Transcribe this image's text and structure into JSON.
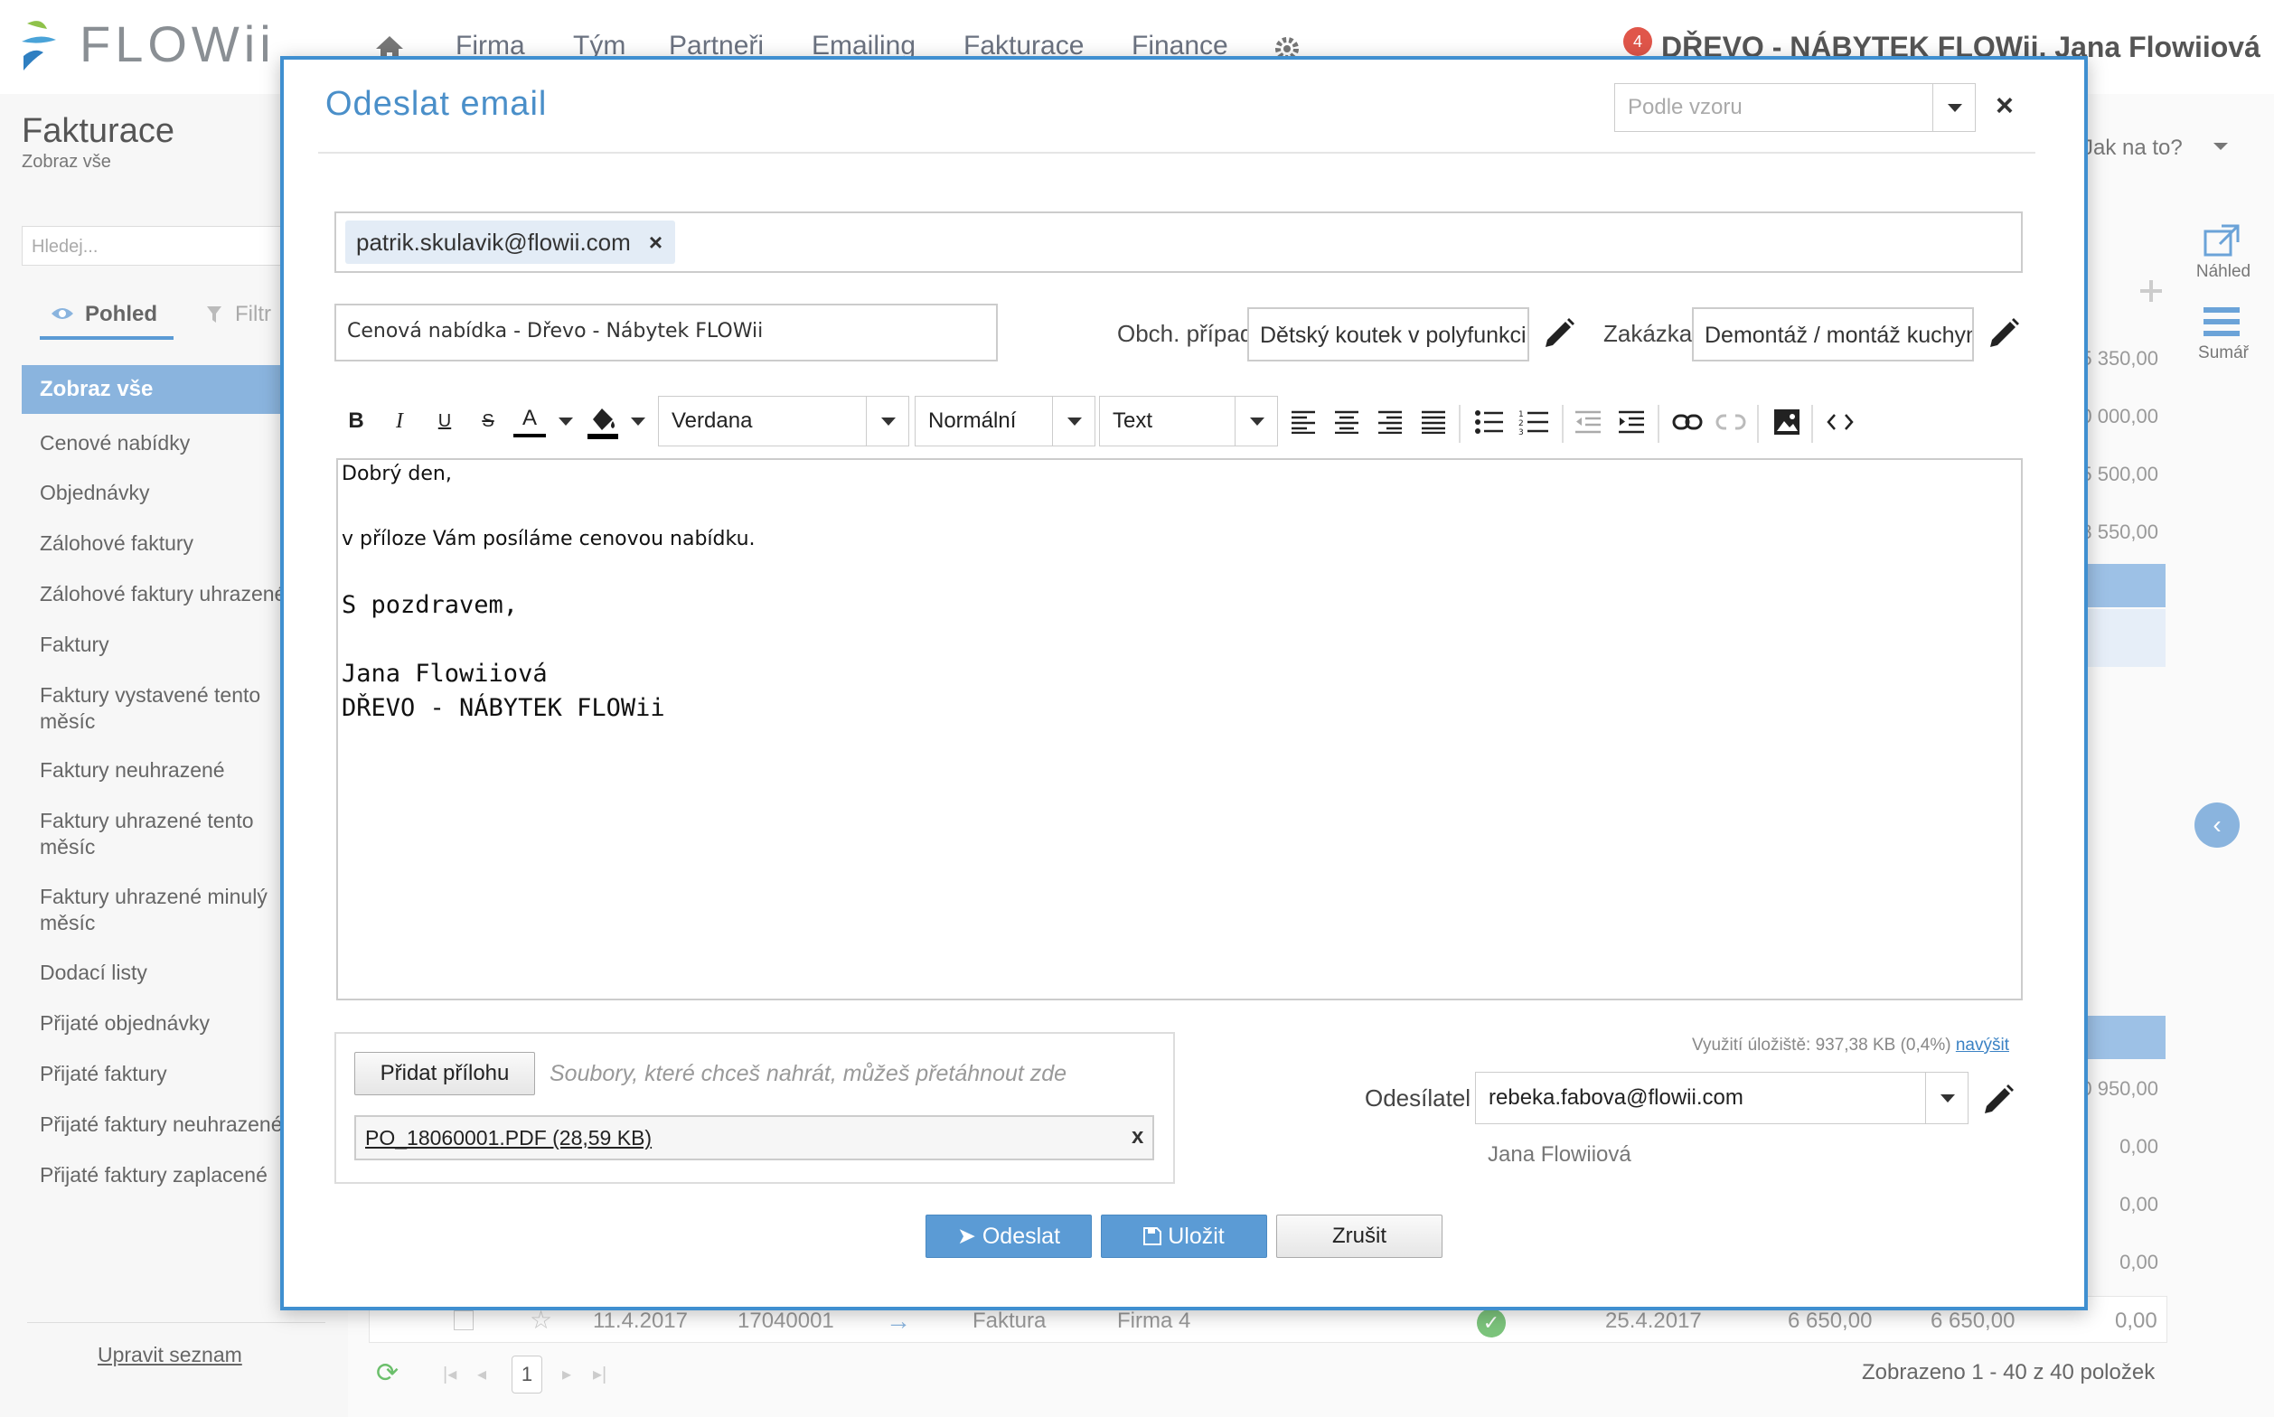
{
  "app": {
    "logo": "FLOWii",
    "nav": [
      "Firma",
      "Tým",
      "Partneři",
      "Emailing",
      "Fakturace",
      "Finance"
    ],
    "notification_count": "4",
    "company_user": "DŘEVO - NÁBYTEK FLOWii, Jana Flowiiová"
  },
  "sidebar": {
    "title": "Fakturace",
    "subtitle": "Zobraz vše",
    "search_placeholder": "Hledej...",
    "tab_view": "Pohled",
    "tab_filter": "Filtr",
    "active_item": "Zobraz vše",
    "items": [
      "Cenové nabídky",
      "Objednávky",
      "Zálohové faktury",
      "Zálohové faktury uhrazené",
      "Faktury",
      "Faktury vystavené tento měsíc",
      "Faktury neuhrazené",
      "Faktury uhrazené tento měsíc",
      "Faktury uhrazené minulý měsíc",
      "Dodací listy",
      "Přijaté objednávky",
      "Přijaté faktury",
      "Přijaté faktury neuhrazené",
      "Přijaté faktury zaplacené"
    ],
    "edit_list": "Upravit seznam"
  },
  "background": {
    "help": "Jak na to?",
    "preview": "Náhled",
    "summary": "Sumář",
    "amounts": [
      "5 350,00",
      "0 000,00",
      "5 500,00",
      "8 550,00",
      "0 950,00",
      "0,00",
      "0,00",
      "0,00",
      "0,00"
    ],
    "last_row": {
      "date": "11.4.2017",
      "number": "17040001",
      "type": "Faktura",
      "partner": "Firma 4",
      "due": "25.4.2017",
      "total": "6 650,00",
      "total2": "6 650,00",
      "remaining": "0,00"
    },
    "page": "1",
    "status": "Zobrazeno 1 - 40 z 40 položek"
  },
  "modal": {
    "title": "Odeslat email",
    "template_placeholder": "Podle vzoru",
    "recipient": "patrik.skulavik@flowii.com",
    "subject": "Cenová nabídka - Dřevo - Nábytek FLOWii",
    "case_label": "Obch. případ",
    "case_value": "Dětský koutek v polyfunkci",
    "order_label": "Zakázka",
    "order_value": "Demontáž / montáž kuchyně",
    "toolbar": {
      "font": "Verdana",
      "size": "Normální",
      "format": "Text"
    },
    "body": {
      "line1": "Dobrý den,",
      "line2": "v příloze Vám posíláme cenovou nabídku.",
      "line3": "S pozdravem,",
      "line4": "Jana Flowiiová",
      "line5": "DŘEVO - NÁBYTEK FLOWii"
    },
    "attach_button": "Přidat přílohu",
    "drop_hint": "Soubory, které chceš nahrát, můžeš přetáhnout zde",
    "attachment": "PO_18060001.PDF (28,59 KB)",
    "storage_text": "Využití úložiště: 937,38 KB (0,4%)",
    "storage_link": "navýšit",
    "sender_label": "Odesílatel",
    "sender_email": "rebeka.fabova@flowii.com",
    "sender_name": "Jana Flowiiová",
    "send": "Odeslat",
    "save": "Uložit",
    "cancel": "Zrušit"
  },
  "colors": {
    "accent": "#5b9bd5",
    "modal_border": "#3f8fd0",
    "title": "#4a8fc9"
  }
}
